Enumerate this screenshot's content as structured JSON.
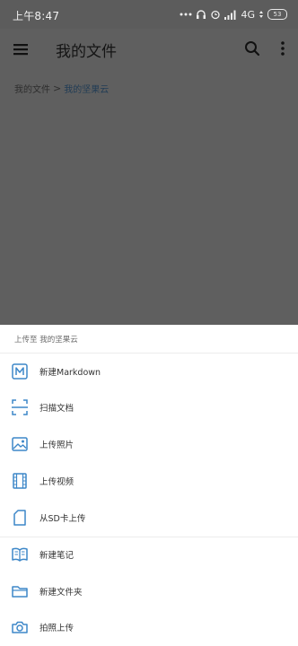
{
  "status_bar": {
    "time": "上午8:47",
    "network": "4G",
    "battery": "53"
  },
  "app_bar": {
    "title": "我的文件"
  },
  "breadcrumb": {
    "root": "我的文件",
    "separator": ">",
    "current": "我的坚果云"
  },
  "sheet": {
    "header": "上传至 我的坚果云",
    "items": [
      {
        "label": "新建Markdown",
        "icon": "markdown-icon"
      },
      {
        "label": "扫描文档",
        "icon": "scan-icon"
      },
      {
        "label": "上传照片",
        "icon": "image-icon"
      },
      {
        "label": "上传视频",
        "icon": "video-icon"
      },
      {
        "label": "从SD卡上传",
        "icon": "sd-card-icon"
      },
      {
        "label": "新建笔记",
        "icon": "notebook-icon"
      },
      {
        "label": "新建文件夹",
        "icon": "folder-icon"
      },
      {
        "label": "拍照上传",
        "icon": "camera-icon"
      }
    ]
  },
  "colors": {
    "accent": "#3d87c8",
    "overlay": "#5f5f5f",
    "sheet_bg": "#ffffff"
  }
}
